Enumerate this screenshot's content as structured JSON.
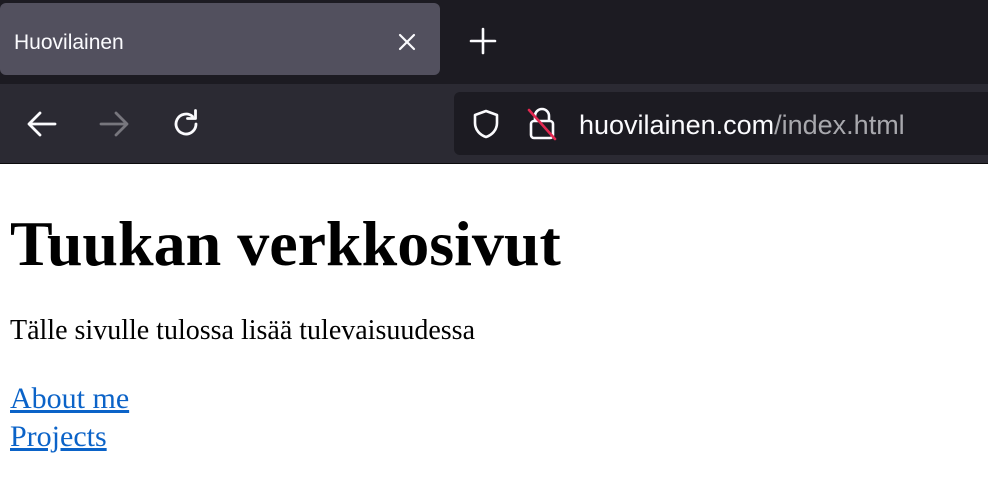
{
  "browser": {
    "tab": {
      "title": "Huovilainen"
    },
    "address_bar": {
      "host": "huovilainen.com",
      "path": "/index.html"
    },
    "icons": {
      "tab_close": "close-icon",
      "new_tab": "plus-icon",
      "back": "arrow-left-icon",
      "forward": "arrow-right-icon",
      "reload": "reload-icon",
      "tracking_protection": "shield-icon",
      "connection": "insecure-lock-icon"
    },
    "colors": {
      "tabstrip_bg": "#1c1b22",
      "active_tab_bg": "#52505e",
      "toolbar_bg": "#2b2a33",
      "urlbar_bg": "#1c1b22",
      "insecure_slash": "#e22850"
    }
  },
  "page": {
    "heading": "Tuukan verkkosivut",
    "paragraph": "Tälle sivulle tulossa lisää tulevaisuudessa",
    "links": [
      {
        "label": "About me"
      },
      {
        "label": "Projects"
      }
    ],
    "colors": {
      "link": "#0b63c8",
      "text": "#000000",
      "background": "#ffffff"
    }
  }
}
